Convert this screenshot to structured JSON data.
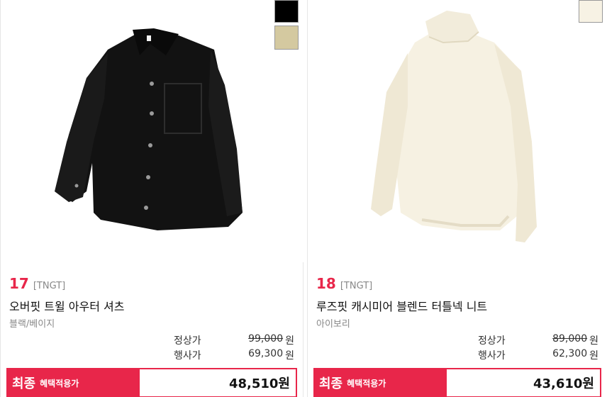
{
  "products": [
    {
      "rank": "17",
      "brand": "[TNGT]",
      "name": "오버핏 트윌 아우터 셔츠",
      "color_text": "블랙/베이지",
      "swatches": [
        "#000000",
        "#d4c9a0"
      ],
      "regular_label": "정상가",
      "regular_price": "99,000",
      "event_label": "행사가",
      "event_price": "69,300",
      "won": "원",
      "final_label": "최종",
      "final_sub": "혜택적용가",
      "final_price": "48,510원"
    },
    {
      "rank": "18",
      "brand": "[TNGT]",
      "name": "루즈핏 캐시미어 블렌드 터틀넥 니트",
      "color_text": "아이보리",
      "swatches": [
        "#f7f2e4"
      ],
      "regular_label": "정상가",
      "regular_price": "89,000",
      "event_label": "행사가",
      "event_price": "62,300",
      "won": "원",
      "final_label": "최종",
      "final_sub": "혜택적용가",
      "final_price": "43,610원"
    }
  ],
  "colors": {
    "accent": "#e8264a"
  }
}
